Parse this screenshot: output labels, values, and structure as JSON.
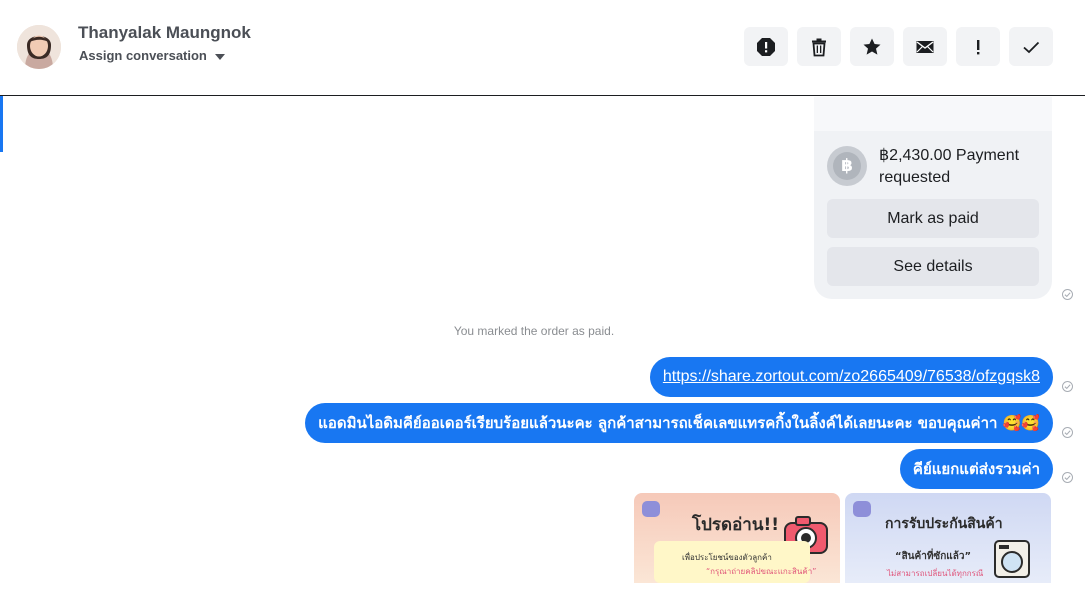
{
  "header": {
    "contact_name": "Thanyalak Maungnok",
    "assign_label": "Assign conversation",
    "toolbar": [
      {
        "name": "report-icon",
        "label": "Report"
      },
      {
        "name": "trash-icon",
        "label": "Delete"
      },
      {
        "name": "star-icon",
        "label": "Star"
      },
      {
        "name": "envelope-icon",
        "label": "Mark as unread"
      },
      {
        "name": "exclamation-icon",
        "label": "Follow up"
      },
      {
        "name": "check-icon",
        "label": "Done"
      }
    ]
  },
  "payment": {
    "currency_icon": "baht-icon",
    "amount_text": "฿2,430.00 Payment requested",
    "mark_paid_label": "Mark as paid",
    "see_details_label": "See details"
  },
  "system_note": "You marked the order as paid.",
  "messages": [
    {
      "type": "link",
      "text": "https://share.zortout.com/zo2665409/76538/ofzgqsk8"
    },
    {
      "type": "text",
      "text": "แอดมินไอดิมคีย์ออเดอร์เรียบร้อยแล้วนะคะ ลูกค้าสามารถเช็คเลขแทรคกิ้งในลิ้งค์ได้เลยนะคะ ขอบคุณค่าา 🥰🥰"
    },
    {
      "type": "text",
      "text": "คีย์แยกแต่ส่งรวมค่า"
    }
  ],
  "images": [
    {
      "title": "โปรดอ่าน!!",
      "line1": "เพื่อประโยชน์ของตัวลูกค้า",
      "line2": "“กรุณาถ่ายคลิปขณะแกะสินค้า”"
    },
    {
      "title": "การรับประกันสินค้า",
      "line1": "“สินค้าที่ซักแล้ว”",
      "line2": "ไม่สามารถเปลี่ยนได้ทุกกรณี"
    }
  ],
  "colors": {
    "accent": "#1877f2",
    "bubble_text": "#ffffff",
    "card_bg": "#f0f2f5",
    "button_bg": "#e4e6eb"
  }
}
